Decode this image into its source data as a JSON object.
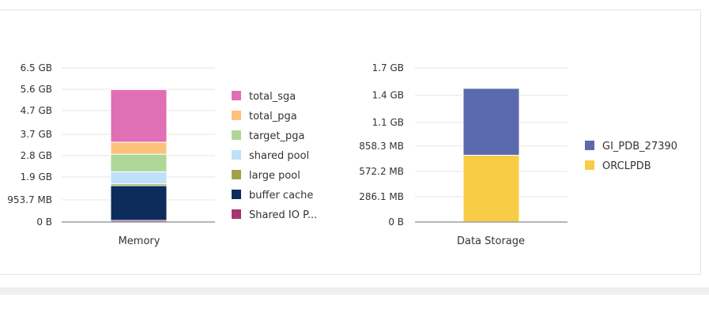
{
  "chart_data": [
    {
      "type": "bar",
      "stacked": true,
      "unit": "MB",
      "categories": [
        "Memory"
      ],
      "ylim": [
        0,
        6656
      ],
      "yticks": [
        {
          "value": 0,
          "label": "0 B"
        },
        {
          "value": 953.7,
          "label": "953.7 MB"
        },
        {
          "value": 1945.6,
          "label": "1.9 GB"
        },
        {
          "value": 2867.2,
          "label": "2.8 GB"
        },
        {
          "value": 3788.8,
          "label": "3.7 GB"
        },
        {
          "value": 4812.8,
          "label": "4.7 GB"
        },
        {
          "value": 5734.4,
          "label": "5.6 GB"
        },
        {
          "value": 6656,
          "label": "6.5 GB"
        }
      ],
      "grid": true,
      "legend": "right",
      "series": [
        {
          "name": "Shared IO P...",
          "values": [
            70
          ],
          "color": "#a6366e"
        },
        {
          "name": "buffer cache",
          "values": [
            1500
          ],
          "color": "#0c2d5c"
        },
        {
          "name": "large pool",
          "values": [
            80
          ],
          "color": "#a0a24a"
        },
        {
          "name": "shared pool",
          "values": [
            520
          ],
          "color": "#bfe0f8"
        },
        {
          "name": "target_pga",
          "values": [
            760
          ],
          "color": "#aed797"
        },
        {
          "name": "total_pga",
          "values": [
            520
          ],
          "color": "#fcc27b"
        },
        {
          "name": "total_sga",
          "values": [
            2270
          ],
          "color": "#e06fb5"
        }
      ],
      "legend_order": [
        "total_sga",
        "total_pga",
        "target_pga",
        "shared pool",
        "large pool",
        "buffer cache",
        "Shared IO P..."
      ]
    },
    {
      "type": "bar",
      "stacked": true,
      "unit": "MB",
      "categories": [
        "Data Storage"
      ],
      "ylim": [
        0,
        1740.8
      ],
      "yticks": [
        {
          "value": 0,
          "label": "0 B"
        },
        {
          "value": 286.1,
          "label": "286.1 MB"
        },
        {
          "value": 572.2,
          "label": "572.2 MB"
        },
        {
          "value": 858.3,
          "label": "858.3 MB"
        },
        {
          "value": 1126.4,
          "label": "1.1 GB"
        },
        {
          "value": 1433.6,
          "label": "1.4 GB"
        },
        {
          "value": 1740.8,
          "label": "1.7 GB"
        }
      ],
      "grid": true,
      "legend": "right",
      "series": [
        {
          "name": "ORCLPDB",
          "values": [
            755
          ],
          "color": "#f9cc47"
        },
        {
          "name": "GI_PDB_27390",
          "values": [
            755
          ],
          "color": "#5b69ae"
        }
      ],
      "legend_order": [
        "GI_PDB_27390",
        "ORCLPDB"
      ]
    }
  ]
}
